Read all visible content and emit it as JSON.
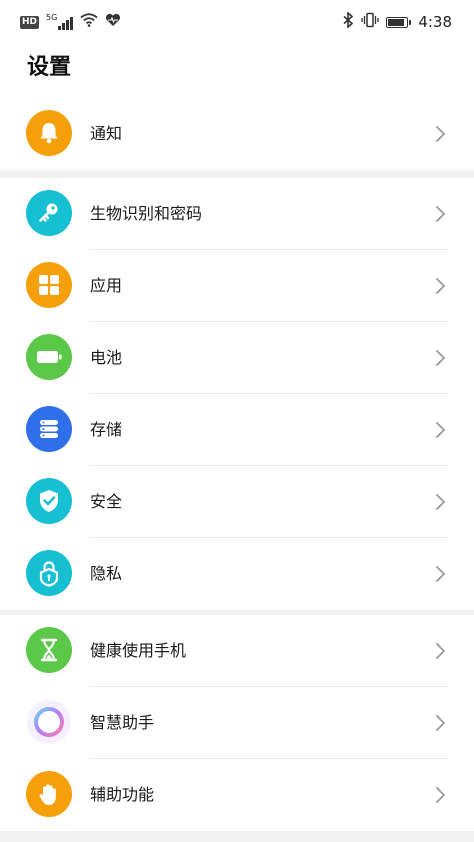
{
  "status_bar": {
    "hd": "HD",
    "network": "5G",
    "time": "4:38",
    "battery_level": 0.85
  },
  "page_title": "设置",
  "groups": [
    {
      "items": [
        {
          "label": "通知",
          "icon": "bell-icon",
          "color": "#F5A00B"
        }
      ]
    },
    {
      "items": [
        {
          "label": "生物识别和密码",
          "icon": "key-icon",
          "color": "#17BFD2"
        },
        {
          "label": "应用",
          "icon": "apps-grid-icon",
          "color": "#F5A00B"
        },
        {
          "label": "电池",
          "icon": "battery-icon",
          "color": "#5CC84A"
        },
        {
          "label": "存储",
          "icon": "storage-icon",
          "color": "#2F6FE9"
        },
        {
          "label": "安全",
          "icon": "shield-check-icon",
          "color": "#17BFD2"
        },
        {
          "label": "隐私",
          "icon": "privacy-lock-icon",
          "color": "#17BFD2"
        }
      ]
    },
    {
      "items": [
        {
          "label": "健康使用手机",
          "icon": "hourglass-icon",
          "color": "#5CC84A"
        },
        {
          "label": "智慧助手",
          "icon": "assistant-ring-icon",
          "color": "#B57CF2"
        },
        {
          "label": "辅助功能",
          "icon": "hand-icon",
          "color": "#F5A00B"
        }
      ]
    }
  ]
}
